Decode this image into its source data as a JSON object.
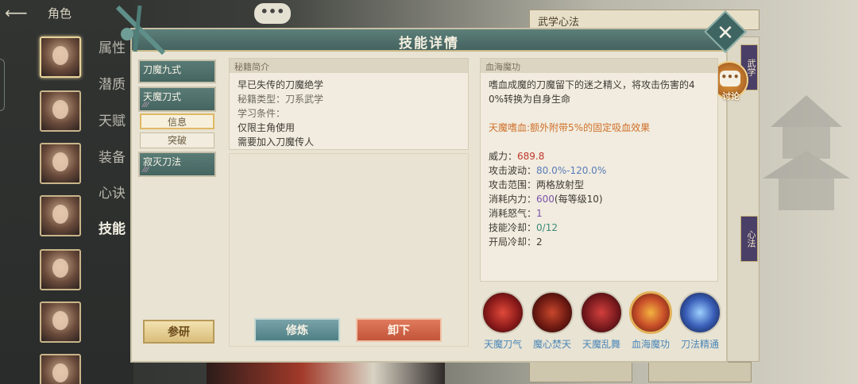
{
  "top": {
    "back_label": "角色",
    "chat_label": "•••"
  },
  "side_tabs": [
    "属性",
    "潜质",
    "天赋",
    "装备",
    "心诀",
    "技能"
  ],
  "background": {
    "panel_title": "武学心法",
    "tag1": "武学",
    "tag2": "心法"
  },
  "dialog": {
    "title": "技能详情",
    "discuss_label": "讨论"
  },
  "skills": [
    {
      "name": "刀魔九式",
      "marks": ""
    },
    {
      "name": "天魔刀式",
      "marks": "⁄⁄⁄"
    },
    {
      "name": "寂灭刀法",
      "marks": "⁄⁄⁄"
    }
  ],
  "subtabs": {
    "info": "信息",
    "breakthrough": "突破"
  },
  "manual": {
    "head": "秘籍简介",
    "lines": [
      "早已失传的刀魔绝学",
      "秘籍类型：刀系武学",
      "学习条件：",
      "仅限主角使用",
      "需要加入刀魔传人"
    ]
  },
  "detail": {
    "head": "血海魔功",
    "desc1": "嗜血成魔的刀魔留下的迷之精义，将攻击伤害的4",
    "desc2": "0%转换为自身生命",
    "effect": "天魔嗜血:额外附带5%的固定吸血效果",
    "stats": [
      {
        "label": "威力：",
        "value": "689.8",
        "cls": "red"
      },
      {
        "label": "攻击波动：",
        "value": "80.0%-120.0%",
        "cls": "blue"
      },
      {
        "label": "攻击范围：",
        "value": "两格放射型",
        "cls": ""
      },
      {
        "label": "消耗内力：",
        "value": "600",
        "extra": "(每等级10)",
        "cls": "purple"
      },
      {
        "label": "消耗怒气：",
        "value": "1",
        "cls": "purple"
      },
      {
        "label": "技能冷却：",
        "value": "0/12",
        "cls": "teal"
      },
      {
        "label": "开局冷却：",
        "value": "2",
        "cls": ""
      }
    ]
  },
  "buttons": {
    "research": "参研",
    "train": "修炼",
    "unequip": "卸下"
  },
  "skill_icons": [
    "天魔刀气",
    "魔心焚天",
    "天魔乱舞",
    "血海魔功",
    "刀法精通"
  ]
}
